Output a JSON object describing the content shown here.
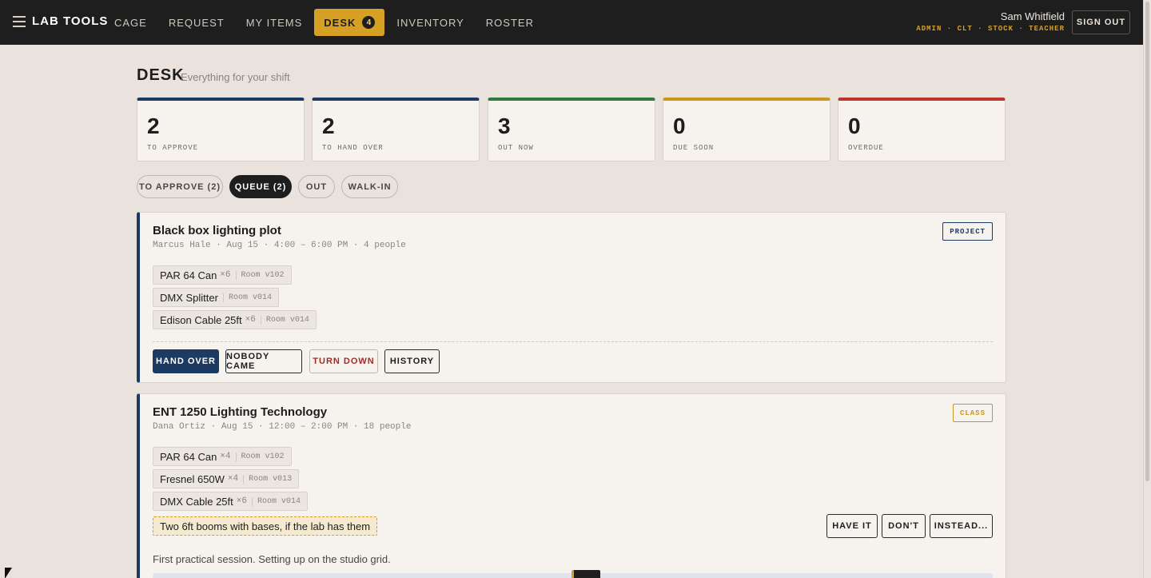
{
  "app": {
    "brand": "LAB TOOLS",
    "nav": [
      {
        "label": "CAGE"
      },
      {
        "label": "REQUEST"
      },
      {
        "label": "MY ITEMS"
      },
      {
        "label": "DESK",
        "badge": "4",
        "active": true
      },
      {
        "label": "INVENTORY"
      },
      {
        "label": "ROSTER"
      }
    ],
    "user": {
      "name": "Sam Whitfield",
      "roles": "ADMIN · CLT · STOCK · TEACHER"
    },
    "sign_out": "SIGN OUT"
  },
  "page": {
    "title": "DESK",
    "subtitle": "Everything for your shift"
  },
  "stats": [
    {
      "value": "2",
      "label": "TO APPROVE",
      "color": "#1d3a63"
    },
    {
      "value": "2",
      "label": "TO HAND OVER",
      "color": "#1d3a63"
    },
    {
      "value": "3",
      "label": "OUT NOW",
      "color": "#2f7a3c"
    },
    {
      "value": "0",
      "label": "DUE SOON",
      "color": "#c9961e"
    },
    {
      "value": "0",
      "label": "OVERDUE",
      "color": "#b9372c"
    }
  ],
  "tabs": [
    {
      "label": "TO APPROVE (2)"
    },
    {
      "label": "QUEUE (2)",
      "active": true
    },
    {
      "label": "OUT"
    },
    {
      "label": "WALK-IN"
    }
  ],
  "cards": [
    {
      "title": "Black box lighting plot",
      "meta": "Marcus Hale · Aug 15 · 4:00 – 6:00 PM · 4 people",
      "tag": "PROJECT",
      "tag_color": "#1d3a63",
      "items": [
        {
          "name": "PAR 64 Can",
          "qty": "×6",
          "room": "Room v102"
        },
        {
          "name": "DMX Splitter",
          "qty": "",
          "room": "Room v014"
        },
        {
          "name": "Edison Cable 25ft",
          "qty": "×6",
          "room": "Room v014"
        }
      ],
      "actions": [
        "HAND OVER",
        "NOBODY CAME",
        "TURN DOWN",
        "HISTORY"
      ]
    },
    {
      "title": "ENT 1250 Lighting Technology",
      "meta": "Dana Ortiz · Aug 15 · 12:00 – 2:00 PM · 18 people",
      "tag": "CLASS",
      "tag_color": "#c9961e",
      "items": [
        {
          "name": "PAR 64 Can",
          "qty": "×4",
          "room": "Room v102"
        },
        {
          "name": "Fresnel 650W",
          "qty": "×4",
          "room": "Room v013"
        },
        {
          "name": "DMX Cable 25ft",
          "qty": "×6",
          "room": "Room v014"
        }
      ],
      "request": "Two 6ft booms with bases, if the lab has them",
      "request_actions": [
        "HAVE IT",
        "DON'T",
        "INSTEAD..."
      ],
      "note": "First practical session. Setting up on the studio grid."
    }
  ]
}
